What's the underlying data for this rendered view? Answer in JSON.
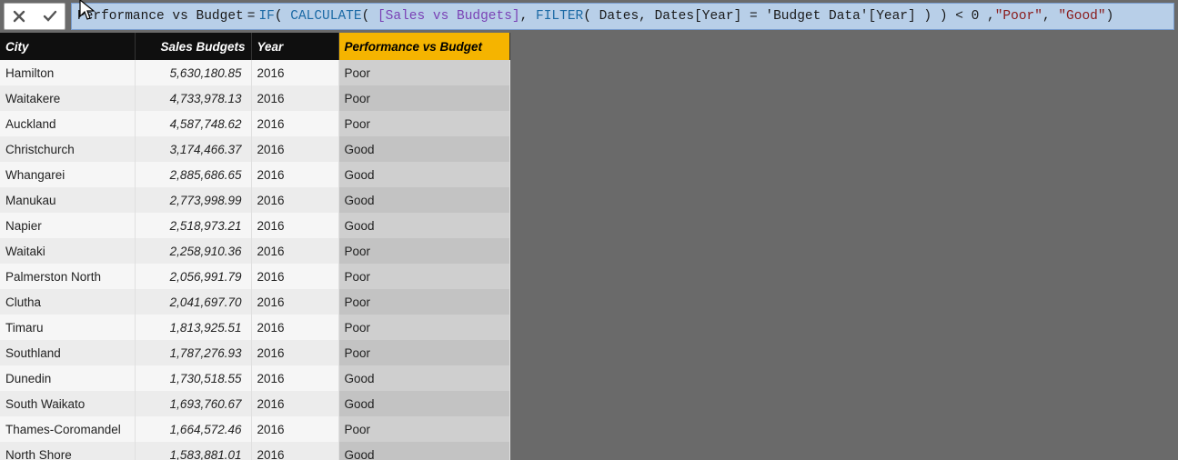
{
  "formula": {
    "measure_name": "Performance vs Budget",
    "tokens": [
      {
        "t": "func",
        "v": "IF"
      },
      {
        "t": "plain",
        "v": "( "
      },
      {
        "t": "func",
        "v": "CALCULATE"
      },
      {
        "t": "plain",
        "v": "( "
      },
      {
        "t": "col",
        "v": "[Sales vs Budgets]"
      },
      {
        "t": "plain",
        "v": ", "
      },
      {
        "t": "func",
        "v": "FILTER"
      },
      {
        "t": "plain",
        "v": "( Dates, Dates[Year] = 'Budget Data'[Year] ) ) < "
      },
      {
        "t": "num",
        "v": "0"
      },
      {
        "t": "plain",
        "v": " ,"
      },
      {
        "t": "str",
        "v": "\"Poor\""
      },
      {
        "t": "plain",
        "v": ", "
      },
      {
        "t": "str",
        "v": "\"Good\""
      },
      {
        "t": "plain",
        "v": ")"
      }
    ]
  },
  "columns": [
    {
      "key": "city",
      "label": "City",
      "cls": "col-city",
      "selected": false
    },
    {
      "key": "budgets",
      "label": "Sales Budgets",
      "cls": "col-budgets",
      "selected": false
    },
    {
      "key": "year",
      "label": "Year",
      "cls": "col-year",
      "selected": false
    },
    {
      "key": "perf",
      "label": "Performance vs Budget",
      "cls": "col-perf",
      "selected": true
    }
  ],
  "rows": [
    {
      "city": "Hamilton",
      "budgets": "5,630,180.85",
      "year": "2016",
      "perf": "Poor"
    },
    {
      "city": "Waitakere",
      "budgets": "4,733,978.13",
      "year": "2016",
      "perf": "Poor"
    },
    {
      "city": "Auckland",
      "budgets": "4,587,748.62",
      "year": "2016",
      "perf": "Poor"
    },
    {
      "city": "Christchurch",
      "budgets": "3,174,466.37",
      "year": "2016",
      "perf": "Good"
    },
    {
      "city": "Whangarei",
      "budgets": "2,885,686.65",
      "year": "2016",
      "perf": "Good"
    },
    {
      "city": "Manukau",
      "budgets": "2,773,998.99",
      "year": "2016",
      "perf": "Good"
    },
    {
      "city": "Napier",
      "budgets": "2,518,973.21",
      "year": "2016",
      "perf": "Good"
    },
    {
      "city": "Waitaki",
      "budgets": "2,258,910.36",
      "year": "2016",
      "perf": "Poor"
    },
    {
      "city": "Palmerston North",
      "budgets": "2,056,991.79",
      "year": "2016",
      "perf": "Poor"
    },
    {
      "city": "Clutha",
      "budgets": "2,041,697.70",
      "year": "2016",
      "perf": "Poor"
    },
    {
      "city": "Timaru",
      "budgets": "1,813,925.51",
      "year": "2016",
      "perf": "Poor"
    },
    {
      "city": "Southland",
      "budgets": "1,787,276.93",
      "year": "2016",
      "perf": "Poor"
    },
    {
      "city": "Dunedin",
      "budgets": "1,730,518.55",
      "year": "2016",
      "perf": "Good"
    },
    {
      "city": "South Waikato",
      "budgets": "1,693,760.67",
      "year": "2016",
      "perf": "Good"
    },
    {
      "city": "Thames-Coromandel",
      "budgets": "1,664,572.46",
      "year": "2016",
      "perf": "Poor"
    },
    {
      "city": "North Shore",
      "budgets": "1,583,881.01",
      "year": "2016",
      "perf": "Good"
    }
  ],
  "icons": {
    "cancel": "cancel",
    "commit": "commit"
  }
}
